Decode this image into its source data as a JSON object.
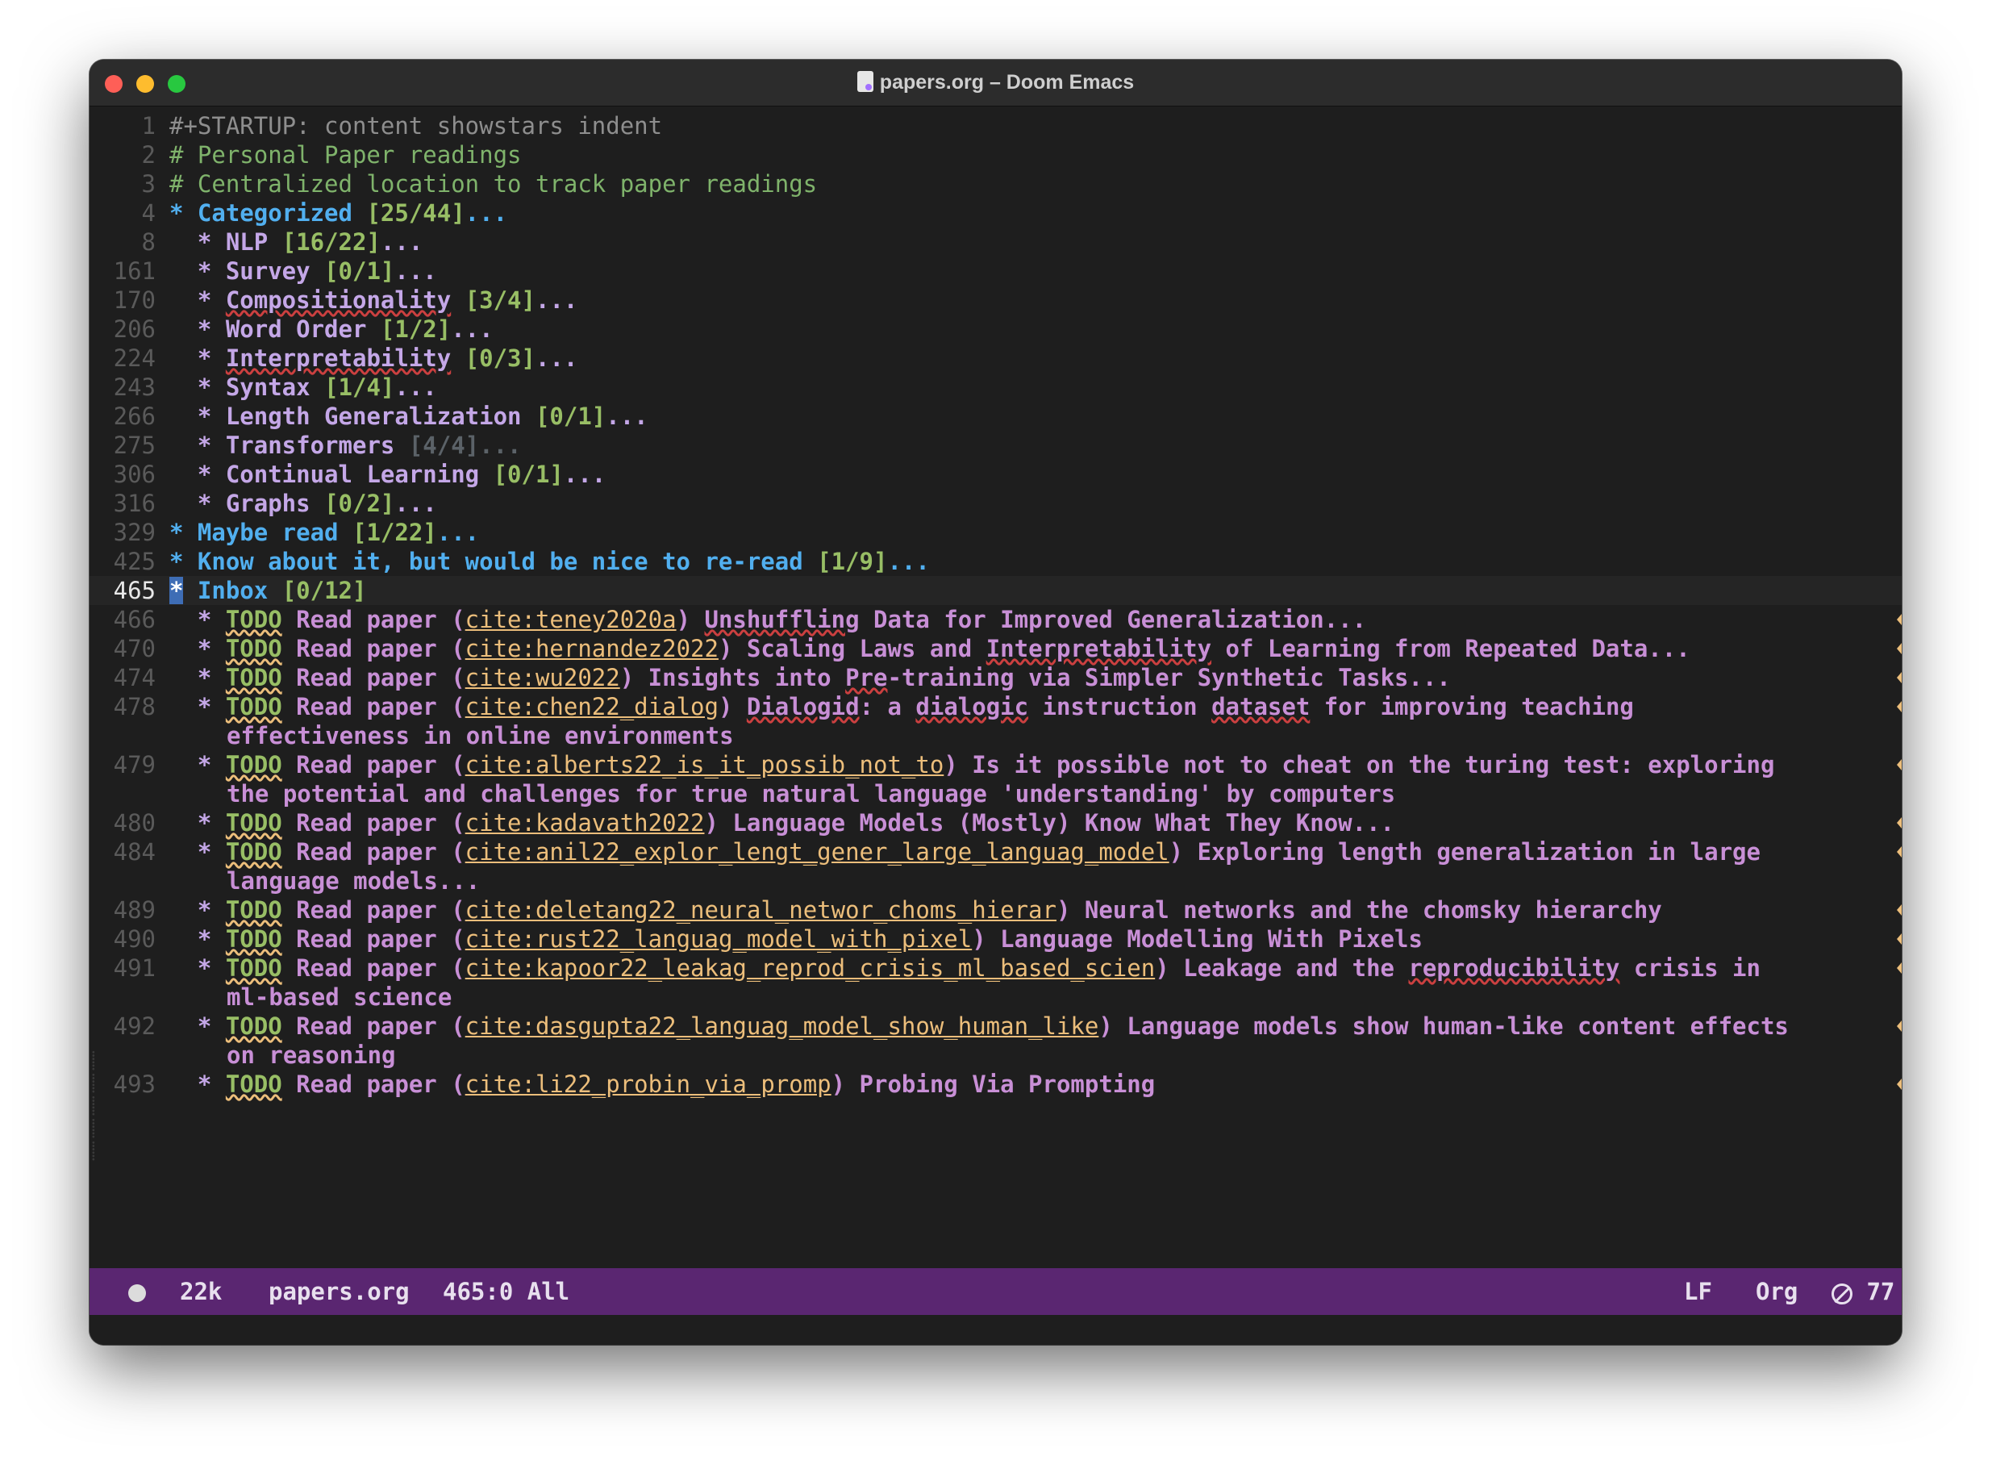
{
  "window": {
    "title": "papers.org – Doom Emacs"
  },
  "lines": [
    {
      "n": "1",
      "segs": [
        {
          "c": "kw",
          "t": "#+STARTUP: content showstars indent"
        }
      ]
    },
    {
      "n": "2",
      "segs": [
        {
          "c": "cmt",
          "t": "# Personal Paper readings"
        }
      ]
    },
    {
      "n": "3",
      "segs": [
        {
          "c": "cmt",
          "t": "# Centralized location to track paper readings"
        }
      ]
    },
    {
      "n": "4",
      "segs": [
        {
          "c": "star1",
          "t": "* "
        },
        {
          "c": "h1",
          "t": "Categorized "
        },
        {
          "c": "cnt",
          "t": "[25/44]"
        },
        {
          "c": "h1",
          "t": "..."
        }
      ]
    },
    {
      "n": "8",
      "segs": [
        {
          "c": "star2",
          "t": "  * "
        },
        {
          "c": "h2",
          "t": "NLP "
        },
        {
          "c": "cnt",
          "t": "[16/22]"
        },
        {
          "c": "h2",
          "t": "..."
        }
      ]
    },
    {
      "n": "161",
      "segs": [
        {
          "c": "star2",
          "t": "  * "
        },
        {
          "c": "h2",
          "t": "Survey "
        },
        {
          "c": "cnt",
          "t": "[0/1]"
        },
        {
          "c": "h2",
          "t": "..."
        }
      ]
    },
    {
      "n": "170",
      "segs": [
        {
          "c": "star2",
          "t": "  * "
        },
        {
          "c": "h2 spell",
          "t": "Compositionality"
        },
        {
          "c": "h2",
          "t": " "
        },
        {
          "c": "cnt",
          "t": "[3/4]"
        },
        {
          "c": "h2",
          "t": "..."
        }
      ]
    },
    {
      "n": "206",
      "segs": [
        {
          "c": "star2",
          "t": "  * "
        },
        {
          "c": "h2",
          "t": "Word Order "
        },
        {
          "c": "cnt",
          "t": "[1/2]"
        },
        {
          "c": "h2",
          "t": "..."
        }
      ]
    },
    {
      "n": "224",
      "segs": [
        {
          "c": "star2",
          "t": "  * "
        },
        {
          "c": "h2 spell",
          "t": "Interpretability"
        },
        {
          "c": "h2",
          "t": " "
        },
        {
          "c": "cnt",
          "t": "[0/3]"
        },
        {
          "c": "h2",
          "t": "..."
        }
      ]
    },
    {
      "n": "243",
      "segs": [
        {
          "c": "star2",
          "t": "  * "
        },
        {
          "c": "h2",
          "t": "Syntax "
        },
        {
          "c": "cnt",
          "t": "[1/4]"
        },
        {
          "c": "h2",
          "t": "..."
        }
      ]
    },
    {
      "n": "266",
      "segs": [
        {
          "c": "star2",
          "t": "  * "
        },
        {
          "c": "h2",
          "t": "Length Generalization "
        },
        {
          "c": "cnt",
          "t": "[0/1]"
        },
        {
          "c": "h2",
          "t": "..."
        }
      ]
    },
    {
      "n": "275",
      "segs": [
        {
          "c": "star2",
          "t": "  * "
        },
        {
          "c": "h2",
          "t": "Transformers "
        },
        {
          "c": "cnt-done",
          "t": "[4/4]..."
        }
      ]
    },
    {
      "n": "306",
      "segs": [
        {
          "c": "star2",
          "t": "  * "
        },
        {
          "c": "h2",
          "t": "Continual Learning "
        },
        {
          "c": "cnt",
          "t": "[0/1]"
        },
        {
          "c": "h2",
          "t": "..."
        }
      ]
    },
    {
      "n": "316",
      "segs": [
        {
          "c": "star2",
          "t": "  * "
        },
        {
          "c": "h2",
          "t": "Graphs "
        },
        {
          "c": "cnt",
          "t": "[0/2]"
        },
        {
          "c": "h2",
          "t": "..."
        }
      ]
    },
    {
      "n": "329",
      "segs": [
        {
          "c": "star1",
          "t": "* "
        },
        {
          "c": "h1",
          "t": "Maybe read "
        },
        {
          "c": "cnt",
          "t": "[1/22]"
        },
        {
          "c": "h1",
          "t": "..."
        }
      ]
    },
    {
      "n": "425",
      "segs": [
        {
          "c": "star1",
          "t": "* "
        },
        {
          "c": "h1",
          "t": "Know about it, but would be nice to re-read "
        },
        {
          "c": "cnt",
          "t": "[1/9]"
        },
        {
          "c": "h1",
          "t": "..."
        }
      ]
    },
    {
      "n": "465",
      "current": true,
      "segs": [
        {
          "c": "star1 cursor-star",
          "t": "*"
        },
        {
          "c": "h1",
          "t": " Inbox "
        },
        {
          "c": "cnt",
          "t": "[0/12]"
        }
      ]
    },
    {
      "n": "466",
      "fringe": true,
      "segs": [
        {
          "c": "star2",
          "t": "  * "
        },
        {
          "c": "todo",
          "t": "TODO"
        },
        {
          "c": "title",
          "t": " Read paper ("
        },
        {
          "c": "cite",
          "t": "cite:teney2020a"
        },
        {
          "c": "title",
          "t": ") "
        },
        {
          "c": "title spell",
          "t": "Unshuffling"
        },
        {
          "c": "title",
          "t": " Data for Improved Generalization..."
        }
      ]
    },
    {
      "n": "470",
      "fringe": true,
      "segs": [
        {
          "c": "star2",
          "t": "  * "
        },
        {
          "c": "todo",
          "t": "TODO"
        },
        {
          "c": "title",
          "t": " Read paper ("
        },
        {
          "c": "cite",
          "t": "cite:hernandez2022"
        },
        {
          "c": "title",
          "t": ") Scaling Laws and "
        },
        {
          "c": "title spell",
          "t": "Interpretability"
        },
        {
          "c": "title",
          "t": " of Learning from Repeated Data..."
        }
      ]
    },
    {
      "n": "474",
      "fringe": true,
      "segs": [
        {
          "c": "star2",
          "t": "  * "
        },
        {
          "c": "todo",
          "t": "TODO"
        },
        {
          "c": "title",
          "t": " Read paper ("
        },
        {
          "c": "cite",
          "t": "cite:wu2022"
        },
        {
          "c": "title",
          "t": ") Insights into "
        },
        {
          "c": "title spell",
          "t": "Pre"
        },
        {
          "c": "title",
          "t": "-training via Simpler Synthetic Tasks..."
        }
      ]
    },
    {
      "n": "478",
      "fringe": true,
      "segs": [
        {
          "c": "star2",
          "t": "  * "
        },
        {
          "c": "todo",
          "t": "TODO"
        },
        {
          "c": "title",
          "t": " Read paper ("
        },
        {
          "c": "cite",
          "t": "cite:chen22_dialog"
        },
        {
          "c": "title",
          "t": ") "
        },
        {
          "c": "title spell",
          "t": "Dialogid"
        },
        {
          "c": "title",
          "t": ": a "
        },
        {
          "c": "title spell",
          "t": "dialogic"
        },
        {
          "c": "title",
          "t": " instruction "
        },
        {
          "c": "title spell",
          "t": "dataset"
        },
        {
          "c": "title",
          "t": " for improving teaching"
        }
      ],
      "cont": "effectiveness in online environments"
    },
    {
      "n": "479",
      "fringe": true,
      "segs": [
        {
          "c": "star2",
          "t": "  * "
        },
        {
          "c": "todo",
          "t": "TODO"
        },
        {
          "c": "title",
          "t": " Read paper ("
        },
        {
          "c": "cite",
          "t": "cite:alberts22_is_it_possib_not_to"
        },
        {
          "c": "title",
          "t": ") Is it possible not to cheat on the turing test: exploring"
        }
      ],
      "cont": "the potential and challenges for true natural language 'understanding' by computers"
    },
    {
      "n": "480",
      "fringe": true,
      "segs": [
        {
          "c": "star2",
          "t": "  * "
        },
        {
          "c": "todo",
          "t": "TODO"
        },
        {
          "c": "title",
          "t": " Read paper ("
        },
        {
          "c": "cite",
          "t": "cite:kadavath2022"
        },
        {
          "c": "title",
          "t": ") Language Models (Mostly) Know What They Know..."
        }
      ]
    },
    {
      "n": "484",
      "fringe": true,
      "segs": [
        {
          "c": "star2",
          "t": "  * "
        },
        {
          "c": "todo",
          "t": "TODO"
        },
        {
          "c": "title",
          "t": " Read paper ("
        },
        {
          "c": "cite",
          "t": "cite:anil22_explor_lengt_gener_large_languag_model"
        },
        {
          "c": "title",
          "t": ") Exploring length generalization in large"
        }
      ],
      "cont": "language models..."
    },
    {
      "n": "489",
      "fringe": true,
      "segs": [
        {
          "c": "star2",
          "t": "  * "
        },
        {
          "c": "todo",
          "t": "TODO"
        },
        {
          "c": "title",
          "t": " Read paper ("
        },
        {
          "c": "cite",
          "t": "cite:deletang22_neural_networ_choms_hierar"
        },
        {
          "c": "title",
          "t": ") Neural networks and the chomsky hierarchy"
        }
      ]
    },
    {
      "n": "490",
      "fringe": true,
      "segs": [
        {
          "c": "star2",
          "t": "  * "
        },
        {
          "c": "todo",
          "t": "TODO"
        },
        {
          "c": "title",
          "t": " Read paper ("
        },
        {
          "c": "cite",
          "t": "cite:rust22_languag_model_with_pixel"
        },
        {
          "c": "title",
          "t": ") Language Modelling With Pixels"
        }
      ]
    },
    {
      "n": "491",
      "fringe": true,
      "segs": [
        {
          "c": "star2",
          "t": "  * "
        },
        {
          "c": "todo",
          "t": "TODO"
        },
        {
          "c": "title",
          "t": " Read paper ("
        },
        {
          "c": "cite",
          "t": "cite:kapoor22_leakag_reprod_crisis_ml_based_scien"
        },
        {
          "c": "title",
          "t": ") Leakage and the "
        },
        {
          "c": "title spell",
          "t": "reproducibility"
        },
        {
          "c": "title",
          "t": " crisis in"
        }
      ],
      "cont": "ml-based science"
    },
    {
      "n": "492",
      "fringe": true,
      "segs": [
        {
          "c": "star2",
          "t": "  * "
        },
        {
          "c": "todo",
          "t": "TODO"
        },
        {
          "c": "title",
          "t": " Read paper ("
        },
        {
          "c": "cite",
          "t": "cite:dasgupta22_languag_model_show_human_like"
        },
        {
          "c": "title",
          "t": ") Language models show human-like content effects"
        }
      ],
      "cont": "on reasoning"
    },
    {
      "n": "493",
      "fringe": true,
      "segs": [
        {
          "c": "star2",
          "t": "  * "
        },
        {
          "c": "todo",
          "t": "TODO"
        },
        {
          "c": "title",
          "t": " Read paper ("
        },
        {
          "c": "cite",
          "t": "cite:li22_probin_via_promp"
        },
        {
          "c": "title",
          "t": ") Probing Via Prompting"
        }
      ]
    }
  ],
  "modeline": {
    "size": "22k",
    "filename": "papers.org",
    "position": "465:0 All",
    "eol": "LF",
    "mode": "Org",
    "checker": "77"
  }
}
